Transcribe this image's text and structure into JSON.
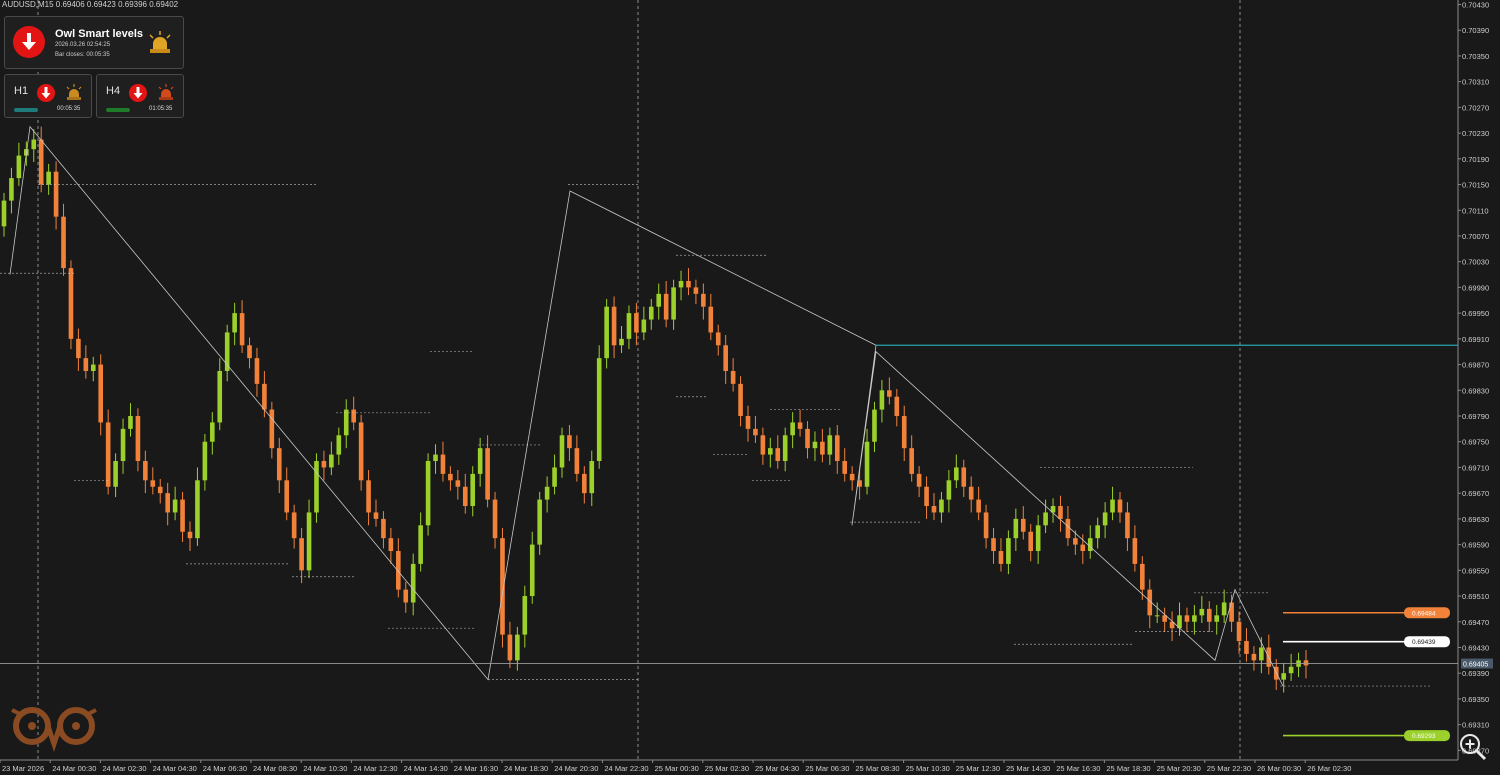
{
  "symbol_info": "AUDUSD,M15  0.69406 0.69423 0.69396 0.69402",
  "panel": {
    "title": "Owl Smart levels",
    "datetime": "2026.03.26 02:54:25",
    "bar_closes": "Bar closes: 00:05:35",
    "direction_icon": "down-arrow-icon",
    "alert_icon": "siren-icon",
    "timeframes": [
      {
        "label": "H1",
        "timer": "00:05:35",
        "direction": "down",
        "bar_color": "#1f7a7a",
        "siren_color": "#c98b1f"
      },
      {
        "label": "H4",
        "timer": "01:05:35",
        "direction": "down",
        "bar_color": "#1f7a2a",
        "siren_color": "#d04a1a"
      }
    ]
  },
  "colors": {
    "background": "#191919",
    "bull": "#9bd12a",
    "bear": "#f2823a",
    "grid": "#cfcfcf",
    "zigzag": "#c8c8c8",
    "level_cyan": "#2aa0b0"
  },
  "chart_data": {
    "type": "candlestick",
    "symbol": "AUDUSD",
    "timeframe": "M15",
    "ylim": [
      0.69255,
      0.70437
    ],
    "y_ticks": [
      "0.70430",
      "0.70390",
      "0.70350",
      "0.70310",
      "0.70270",
      "0.70230",
      "0.70190",
      "0.70150",
      "0.70110",
      "0.70070",
      "0.70030",
      "0.69990",
      "0.69950",
      "0.69910",
      "0.69870",
      "0.69830",
      "0.69790",
      "0.69750",
      "0.69710",
      "0.69670",
      "0.69630",
      "0.69590",
      "0.69550",
      "0.69510",
      "0.69470",
      "0.69430",
      "0.69390",
      "0.69350",
      "0.69310",
      "0.69270"
    ],
    "x_ticks": [
      "23 Mar 2026",
      "24 Mar 00:30",
      "24 Mar 02:30",
      "24 Mar 04:30",
      "24 Mar 06:30",
      "24 Mar 08:30",
      "24 Mar 10:30",
      "24 Mar 12:30",
      "24 Mar 14:30",
      "24 Mar 16:30",
      "24 Mar 18:30",
      "24 Mar 20:30",
      "24 Mar 22:30",
      "25 Mar 00:30",
      "25 Mar 02:30",
      "25 Mar 04:30",
      "25 Mar 06:30",
      "25 Mar 08:30",
      "25 Mar 10:30",
      "25 Mar 12:30",
      "25 Mar 14:30",
      "25 Mar 16:30",
      "25 Mar 18:30",
      "25 Mar 20:30",
      "25 Mar 22:30",
      "26 Mar 00:30",
      "26 Mar 02:30"
    ],
    "close_series": [
      0.70125,
      0.7016,
      0.70195,
      0.70205,
      0.7022,
      0.7015,
      0.7017,
      0.701,
      0.7002,
      0.6991,
      0.6988,
      0.6986,
      0.6987,
      0.6978,
      0.6968,
      0.6972,
      0.6977,
      0.6979,
      0.6972,
      0.6969,
      0.6968,
      0.6967,
      0.6964,
      0.6966,
      0.6961,
      0.696,
      0.6969,
      0.6975,
      0.6978,
      0.6986,
      0.6992,
      0.6995,
      0.699,
      0.6988,
      0.6984,
      0.698,
      0.6974,
      0.6969,
      0.6964,
      0.696,
      0.6955,
      0.6964,
      0.6972,
      0.6971,
      0.6973,
      0.6976,
      0.698,
      0.6978,
      0.6969,
      0.6964,
      0.6963,
      0.696,
      0.6958,
      0.6952,
      0.695,
      0.6956,
      0.6962,
      0.6972,
      0.6973,
      0.697,
      0.6969,
      0.6968,
      0.6965,
      0.697,
      0.6974,
      0.6966,
      0.696,
      0.6945,
      0.6941,
      0.6945,
      0.6951,
      0.6959,
      0.6966,
      0.6968,
      0.6971,
      0.6976,
      0.6974,
      0.697,
      0.6967,
      0.6972,
      0.6988,
      0.6996,
      0.699,
      0.6991,
      0.6995,
      0.6992,
      0.6994,
      0.6996,
      0.6998,
      0.6994,
      0.6999,
      0.7,
      0.6999,
      0.6998,
      0.6996,
      0.6992,
      0.699,
      0.6986,
      0.6984,
      0.6979,
      0.6977,
      0.6976,
      0.6973,
      0.6974,
      0.6972,
      0.6976,
      0.6978,
      0.6977,
      0.6974,
      0.6975,
      0.6973,
      0.6976,
      0.6972,
      0.697,
      0.6969,
      0.6968,
      0.6975,
      0.698,
      0.6983,
      0.6982,
      0.6979,
      0.6974,
      0.697,
      0.6968,
      0.6965,
      0.6964,
      0.6966,
      0.6969,
      0.6971,
      0.6968,
      0.6966,
      0.6964,
      0.696,
      0.6958,
      0.6956,
      0.696,
      0.6963,
      0.6961,
      0.6958,
      0.6962,
      0.6964,
      0.6965,
      0.6963,
      0.696,
      0.6959,
      0.6958,
      0.696,
      0.6962,
      0.6964,
      0.6966,
      0.6964,
      0.696,
      0.6956,
      0.6952,
      0.6948,
      0.6948,
      0.6947,
      0.6946,
      0.6948,
      0.6947,
      0.6948,
      0.6949,
      0.6947,
      0.6948,
      0.695,
      0.6947,
      0.6944,
      0.6942,
      0.6941,
      0.6943,
      0.694,
      0.6938,
      0.6939,
      0.694,
      0.6941,
      0.69402
    ],
    "levels": [
      {
        "label": "0.69484",
        "value": 0.69484,
        "color": "#f2823a"
      },
      {
        "label": "0.69439",
        "value": 0.69439,
        "color": "#ffffff"
      },
      {
        "label": "0.69293",
        "value": 0.69293,
        "color": "#9bd12a"
      }
    ],
    "current_price": {
      "label": "0.69405",
      "value": 0.69405
    },
    "cyan_level": 0.699,
    "zigzag": [
      0.7001,
      0.7024,
      0.6938,
      0.7014,
      0.699,
      0.6962,
      0.6989,
      0.6941,
      0.6952,
      0.6937
    ],
    "grid": true
  }
}
